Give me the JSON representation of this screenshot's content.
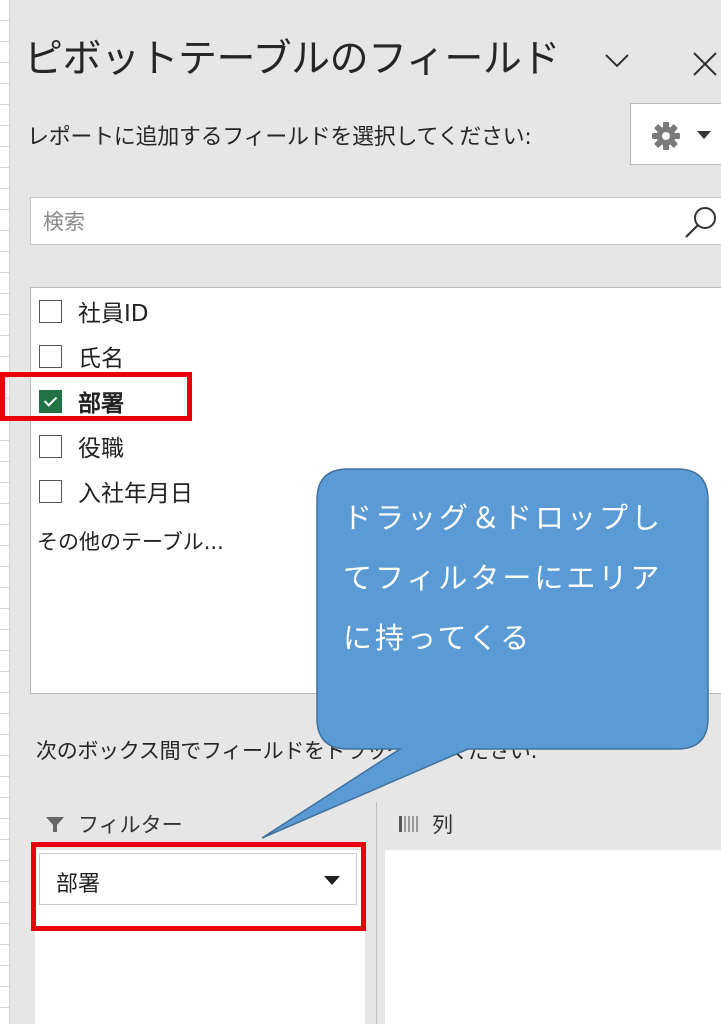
{
  "pane": {
    "title": "ピボットテーブルのフィールド",
    "subtitle": "レポートに追加するフィールドを選択してください:",
    "collapse_icon": "chevron-down-icon",
    "close_icon": "close-icon",
    "tools_icon": "gear-icon"
  },
  "search": {
    "placeholder": "検索",
    "value": "",
    "icon": "search-icon"
  },
  "fields": [
    {
      "label": "社員ID",
      "checked": false
    },
    {
      "label": "氏名",
      "checked": false
    },
    {
      "label": "部署",
      "checked": true
    },
    {
      "label": "役職",
      "checked": false
    },
    {
      "label": "入社年月日",
      "checked": false
    }
  ],
  "more_tables_label": "その他のテーブル...",
  "drag_hint": "次のボックス間でフィールドをドラッグしてください:",
  "areas": {
    "filter": {
      "label": "フィルター",
      "icon": "filter-icon",
      "items": [
        "部署"
      ]
    },
    "columns": {
      "label": "列",
      "icon": "columns-icon",
      "items": []
    }
  },
  "annotation": {
    "callout_lines": [
      "ドラッグ＆ドロップし",
      "てフィルターにエリア",
      "に持ってくる"
    ],
    "callout_color": "#5b9bd5",
    "highlight_color": "#e8000b"
  },
  "colors": {
    "checkbox_checked": "#217346",
    "panel_bg": "#e6e6e6"
  }
}
